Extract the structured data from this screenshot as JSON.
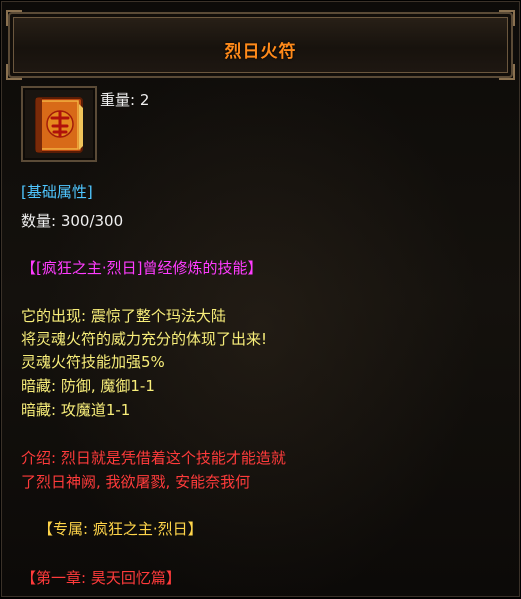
{
  "tooltip": {
    "title": "烈日火符",
    "weight_label": "重量: ",
    "weight_value": "2",
    "section_header": "[基础属性]",
    "quantity_label": "数量: ",
    "quantity_value": "300/300",
    "skill_header": "【[疯狂之主·烈日]曾经修炼的技能】",
    "description_lines": [
      "它的出现: 震惊了整个玛法大陆",
      "将灵魂火符的威力充分的体现了出来!",
      "灵魂火符技能加强5%",
      "暗藏: 防御, 魔御1-1",
      "暗藏: 攻魔道1-1"
    ],
    "intro_lines": [
      "介绍: 烈日就是凭借着这个技能才能造就",
      "了烈日神阙, 我欲屠戮, 安能奈我何"
    ],
    "exclusive": "【专属: 疯狂之主·烈日】",
    "chapter": "【第一章: 昊天回忆篇】"
  },
  "colors": {
    "title": "#ff8a1a",
    "section": "#4fc6ff",
    "skill_header": "#ff3cff",
    "description": "#f8ee7a",
    "intro": "#ff3b3b",
    "exclusive": "#ffd54a"
  },
  "icon": "talisman-book-icon"
}
